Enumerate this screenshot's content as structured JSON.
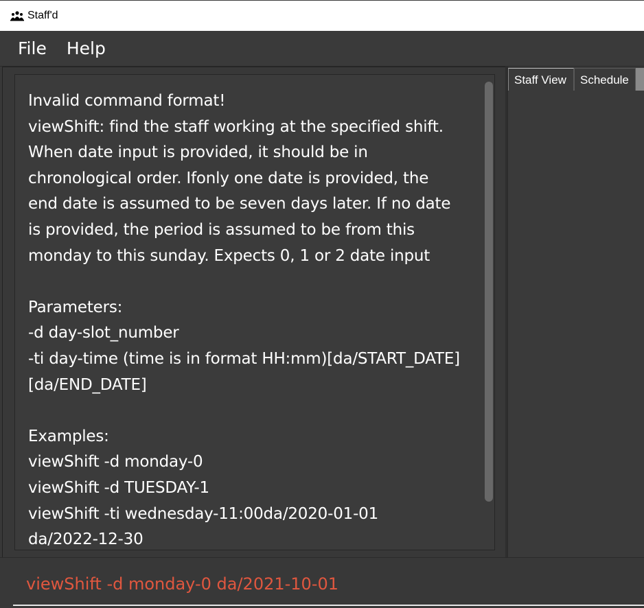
{
  "window": {
    "title": "Staff'd",
    "app_icon": "people-group-icon"
  },
  "menu": {
    "items": [
      "File",
      "Help"
    ]
  },
  "result_display": {
    "lines": [
      "Invalid command format!",
      "viewShift: find the staff working at the specified shift.",
      "When date input is provided, it should be in",
      "chronological order. Ifonly one date is provided, the",
      "end date is assumed to be seven days later. If no date",
      "is provided, the period is assumed to be from this",
      "monday to this sunday. Expects 0, 1 or 2 date input",
      "",
      "Parameters:",
      "-d day-slot_number",
      "-ti day-time (time is in format HH:mm)[da/START_DATE]",
      "[da/END_DATE]",
      "",
      "Examples:",
      "viewShift -d monday-0",
      "viewShift -d TUESDAY-1",
      "viewShift -ti wednesday-11:00da/2020-01-01",
      "da/2022-12-30"
    ]
  },
  "tabs": [
    {
      "label": "Staff View"
    },
    {
      "label": "Schedule"
    }
  ],
  "command_box": {
    "value": "viewShift -d monday-0 da/2021-10-01",
    "error_color": "#e0573f"
  },
  "colors": {
    "background": "#383838",
    "text": "#ffffff"
  }
}
